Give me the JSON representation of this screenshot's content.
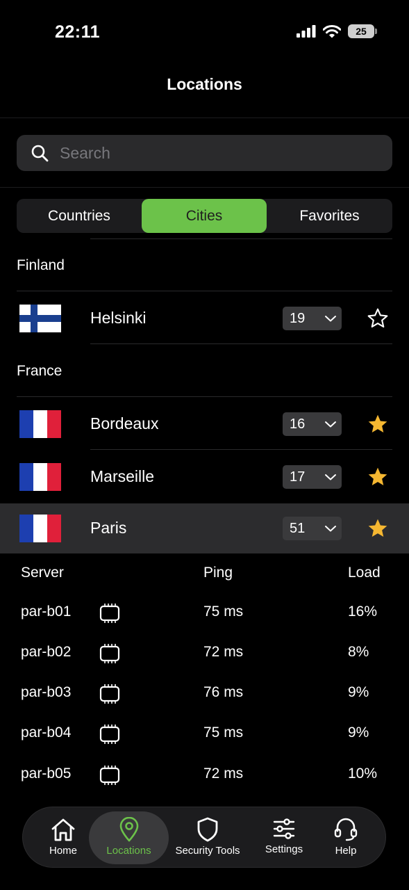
{
  "status_bar": {
    "time": "22:11",
    "battery": "25"
  },
  "nav": {
    "title": "Locations"
  },
  "search": {
    "placeholder": "Search"
  },
  "segments": {
    "countries": "Countries",
    "cities": "Cities",
    "favorites": "Favorites",
    "selected": "Cities"
  },
  "sections": [
    {
      "country": "Finland",
      "cities": [
        {
          "name": "Helsinki",
          "count": "19",
          "favorite": false,
          "flag": "finland"
        }
      ]
    },
    {
      "country": "France",
      "cities": [
        {
          "name": "Bordeaux",
          "count": "16",
          "favorite": true,
          "flag": "france"
        },
        {
          "name": "Marseille",
          "count": "17",
          "favorite": true,
          "flag": "france"
        },
        {
          "name": "Paris",
          "count": "51",
          "favorite": true,
          "flag": "france",
          "expanded": true
        }
      ]
    }
  ],
  "servers": {
    "headers": {
      "server": "Server",
      "ping": "Ping",
      "load": "Load"
    },
    "rows": [
      {
        "name": "par-b01",
        "ping": "75 ms",
        "load": "16%"
      },
      {
        "name": "par-b02",
        "ping": "72 ms",
        "load": "8%"
      },
      {
        "name": "par-b03",
        "ping": "76 ms",
        "load": "9%"
      },
      {
        "name": "par-b04",
        "ping": "75 ms",
        "load": "9%"
      },
      {
        "name": "par-b05",
        "ping": "72 ms",
        "load": "10%"
      }
    ]
  },
  "tabbar": {
    "home": "Home",
    "locations": "Locations",
    "security": "Security Tools",
    "settings": "Settings",
    "help": "Help",
    "active": "Locations"
  },
  "colors": {
    "accent": "#6cc24a",
    "star": "#f5b731",
    "background": "#000000",
    "selected_row": "#2c2c2e"
  }
}
